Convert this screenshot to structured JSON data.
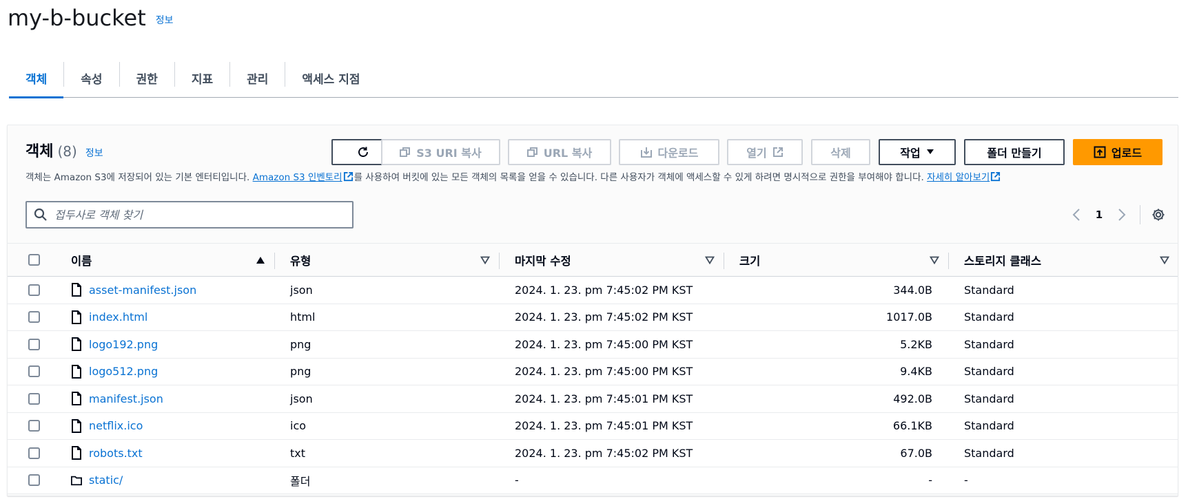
{
  "header": {
    "bucket_name": "my-b-bucket",
    "info_label": "정보"
  },
  "tabs": [
    {
      "label": "객체",
      "active": true
    },
    {
      "label": "속성",
      "active": false
    },
    {
      "label": "권한",
      "active": false
    },
    {
      "label": "지표",
      "active": false
    },
    {
      "label": "관리",
      "active": false
    },
    {
      "label": "액세스 지점",
      "active": false
    }
  ],
  "objects_panel": {
    "title": "객체",
    "count": "(8)",
    "info_label": "정보",
    "description_prefix": "객체는 Amazon S3에 저장되어 있는 기본 엔터티입니다. ",
    "inventory_link": "Amazon S3 인벤토리",
    "description_middle": "를 사용하여 버킷에 있는 모든 객체의 목록을 얻을 수 있습니다. 다른 사용자가 객체에 액세스할 수 있게 하려면 명시적으로 권한을 부여해야 합니다. ",
    "learn_more_link": "자세히 알아보기",
    "buttons": {
      "copy_s3_uri": "S3 URI 복사",
      "copy_url": "URL 복사",
      "download": "다운로드",
      "open": "열기",
      "delete": "삭제",
      "actions": "작업",
      "create_folder": "폴더 만들기",
      "upload": "업로드"
    },
    "search_placeholder": "접두사로 객체 찾기",
    "current_page": "1"
  },
  "table": {
    "headers": {
      "name": "이름",
      "type": "유형",
      "last_modified": "마지막 수정",
      "size": "크기",
      "storage_class": "스토리지 클래스"
    },
    "rows": [
      {
        "name": "asset-manifest.json",
        "type": "json",
        "modified": "2024. 1. 23. pm 7:45:02 PM KST",
        "size": "344.0B",
        "storage_class": "Standard",
        "icon": "file-icon"
      },
      {
        "name": "index.html",
        "type": "html",
        "modified": "2024. 1. 23. pm 7:45:02 PM KST",
        "size": "1017.0B",
        "storage_class": "Standard",
        "icon": "file-icon"
      },
      {
        "name": "logo192.png",
        "type": "png",
        "modified": "2024. 1. 23. pm 7:45:00 PM KST",
        "size": "5.2KB",
        "storage_class": "Standard",
        "icon": "file-icon"
      },
      {
        "name": "logo512.png",
        "type": "png",
        "modified": "2024. 1. 23. pm 7:45:00 PM KST",
        "size": "9.4KB",
        "storage_class": "Standard",
        "icon": "file-icon"
      },
      {
        "name": "manifest.json",
        "type": "json",
        "modified": "2024. 1. 23. pm 7:45:01 PM KST",
        "size": "492.0B",
        "storage_class": "Standard",
        "icon": "file-icon"
      },
      {
        "name": "netflix.ico",
        "type": "ico",
        "modified": "2024. 1. 23. pm 7:45:01 PM KST",
        "size": "66.1KB",
        "storage_class": "Standard",
        "icon": "file-icon"
      },
      {
        "name": "robots.txt",
        "type": "txt",
        "modified": "2024. 1. 23. pm 7:45:02 PM KST",
        "size": "67.0B",
        "storage_class": "Standard",
        "icon": "file-icon"
      },
      {
        "name": "static/",
        "type": "폴더",
        "modified": "-",
        "size": "-",
        "storage_class": "-",
        "icon": "folder-icon"
      }
    ]
  },
  "colors": {
    "accent_link": "#0972d3",
    "primary_button": "#ff9900",
    "text": "#000716",
    "disabled": "#9ba7b6"
  }
}
